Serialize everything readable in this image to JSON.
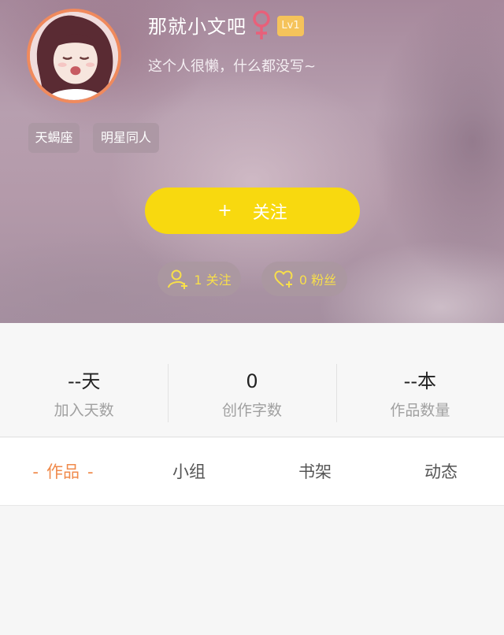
{
  "profile": {
    "username": "那就小文吧",
    "gender_icon": "female-icon",
    "level": "Lv1",
    "bio": "这个人很懒，什么都没写~",
    "tags": [
      "天蝎座",
      "明星同人"
    ],
    "follow_button": {
      "plus": "+",
      "label": "关注"
    },
    "following": {
      "icon": "user-plus-icon",
      "label": "1 关注"
    },
    "fans": {
      "icon": "heart-plus-icon",
      "label": "0 粉丝"
    }
  },
  "stats": [
    {
      "value": "--天",
      "label": "加入天数"
    },
    {
      "value": "0",
      "label": "创作字数"
    },
    {
      "value": "--本",
      "label": "作品数量"
    }
  ],
  "tabs": {
    "active_dash": "-",
    "items": [
      "作品",
      "小组",
      "书架",
      "动态"
    ]
  },
  "colors": {
    "accent": "#f08a4b",
    "follow_button": "#f8d90f",
    "level_badge": "#f5c35b",
    "gender": "#e8607a",
    "pill_text": "#f8df4a"
  }
}
